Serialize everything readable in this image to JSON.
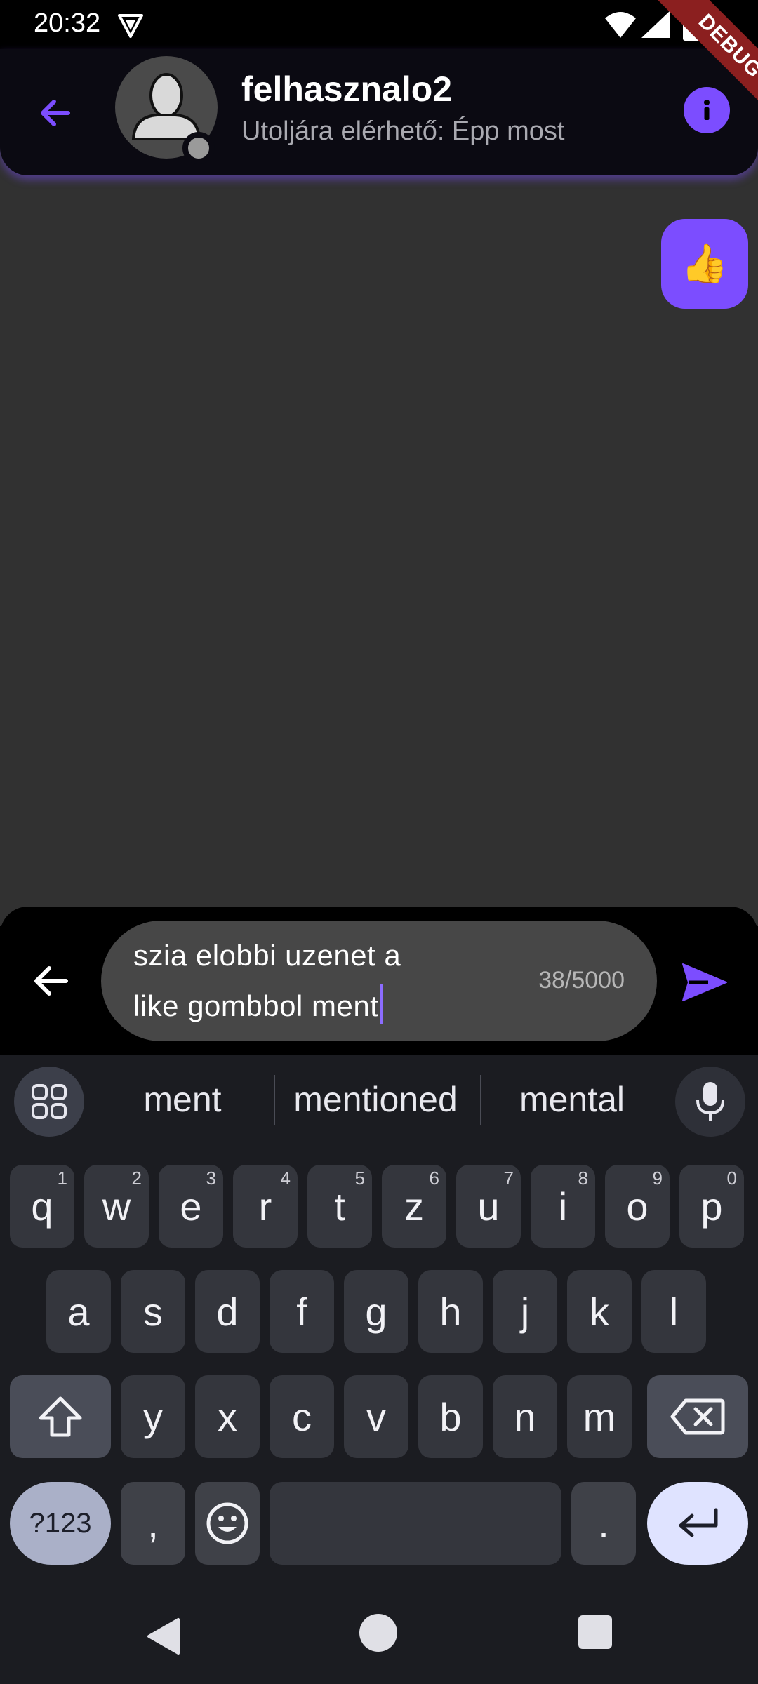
{
  "status_bar": {
    "time": "20:32"
  },
  "debug_ribbon": {
    "label": "DEBUG"
  },
  "header": {
    "contact_name": "felhasznalo2",
    "contact_status": "Utoljára elérhető: Épp most"
  },
  "chat": {
    "messages": [
      {
        "from": "me",
        "content": "👍"
      }
    ]
  },
  "composer": {
    "text_line1": "szia elobbi uzenet a",
    "text_line2": "like gombbol ment",
    "counter": "38/5000"
  },
  "keyboard": {
    "suggestions": [
      "ment",
      "mentioned",
      "mental"
    ],
    "row1": [
      {
        "k": "q",
        "h": "1"
      },
      {
        "k": "w",
        "h": "2"
      },
      {
        "k": "e",
        "h": "3"
      },
      {
        "k": "r",
        "h": "4"
      },
      {
        "k": "t",
        "h": "5"
      },
      {
        "k": "z",
        "h": "6"
      },
      {
        "k": "u",
        "h": "7"
      },
      {
        "k": "i",
        "h": "8"
      },
      {
        "k": "o",
        "h": "9"
      },
      {
        "k": "p",
        "h": "0"
      }
    ],
    "row2": [
      "a",
      "s",
      "d",
      "f",
      "g",
      "h",
      "j",
      "k",
      "l"
    ],
    "row3": [
      "y",
      "x",
      "c",
      "v",
      "b",
      "n",
      "m"
    ],
    "num_key": "?123",
    "comma_key": ",",
    "period_key": "."
  },
  "colors": {
    "accent": "#7c4dff",
    "chat_bg": "#313131",
    "keyboard_bg": "#1b1c21"
  }
}
